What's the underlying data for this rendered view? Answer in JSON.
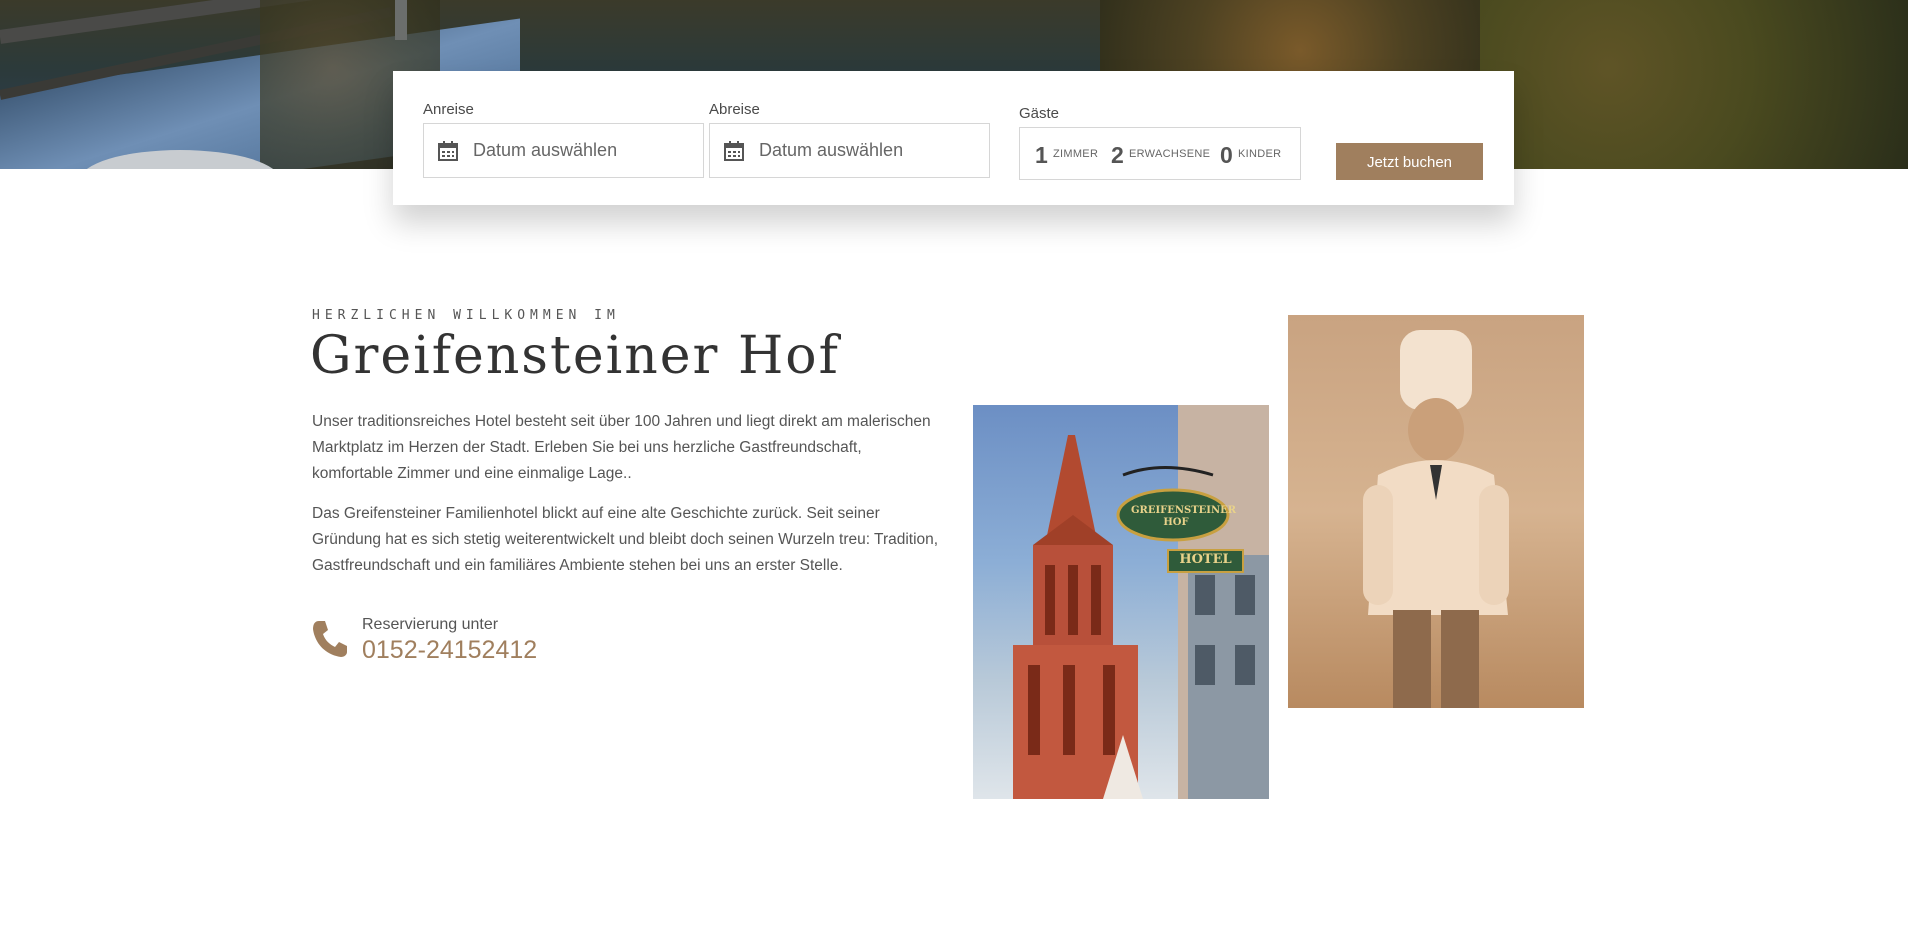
{
  "booking": {
    "arrival_label": "Anreise",
    "arrival_placeholder": "Datum auswählen",
    "departure_label": "Abreise",
    "departure_placeholder": "Datum auswählen",
    "guests_label": "Gäste",
    "rooms_count": "1",
    "rooms_label": "ZIMMER",
    "adults_count": "2",
    "adults_label": "ERWACHSENE",
    "children_count": "0",
    "children_label": "KINDER",
    "book_button": "Jetzt buchen"
  },
  "welcome": {
    "kicker": "HERZLICHEN WILLKOMMEN IM",
    "title": "Greifensteiner Hof",
    "paragraph1": "Unser traditionsreiches Hotel besteht seit über 100 Jahren und liegt direkt am malerischen Marktplatz im Herzen der Stadt. Erleben Sie bei uns herzliche Gastfreundschaft, komfortable Zimmer und eine einmalige Lage..",
    "paragraph2": "Das Greifensteiner Familienhotel blickt auf eine alte Geschichte zurück. Seit seiner Gründung hat es sich stetig weiterentwickelt und bleibt doch seinen Wurzeln treu: Tradition, Gastfreundschaft und ein familiäres Ambiente stehen bei uns an erster Stelle.",
    "reservation_label": "Reservierung unter",
    "reservation_phone": "0152-24152412"
  },
  "colors": {
    "accent": "#a07f5e",
    "text": "#555555",
    "heading": "#333333"
  },
  "icons": {
    "date_icon": "calendar-icon",
    "phone_icon": "phone-icon"
  },
  "images": {
    "church_sign_text_1": "GREIFENSTEINER HOF",
    "church_sign_text_2": "HOTEL"
  }
}
